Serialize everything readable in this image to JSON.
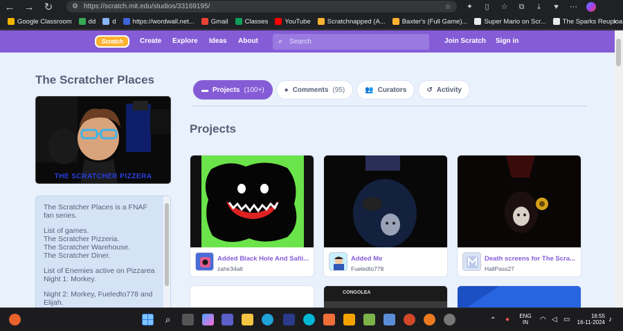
{
  "browser": {
    "url": "https://scratch.mit.edu/studios/33169195/",
    "bookmarks": [
      {
        "label": "Google Classroom",
        "color": "#f4b400"
      },
      {
        "label": "dd",
        "color": "#34a853"
      },
      {
        "label": "d",
        "color": "#8ab4f8"
      },
      {
        "label": "https://wordwall.net...",
        "color": "#3c64d8"
      },
      {
        "label": "Gmail",
        "color": "#ea4335"
      },
      {
        "label": "Classes",
        "color": "#0f9d58"
      },
      {
        "label": "YouTube",
        "color": "#ff0000"
      },
      {
        "label": "Scratchnapped (A...",
        "color": "#fcb230"
      },
      {
        "label": "Baxter's (Full Game)...",
        "color": "#fcb230"
      },
      {
        "label": "Super Mario on Scr...",
        "color": "#e8eaed"
      },
      {
        "label": "The Sparks Reuploa...",
        "color": "#e8eaed"
      }
    ]
  },
  "nav": {
    "logo": "Scratch",
    "create": "Create",
    "explore": "Explore",
    "ideas": "Ideas",
    "about": "About",
    "search_placeholder": "Search",
    "join": "Join Scratch",
    "signin": "Sign in"
  },
  "studio": {
    "title": "The Scratcher Places",
    "thumbnail_caption": "THE SCRATCHER PIZZERA",
    "description": {
      "intro": "The Scratcher Places is a FNAF fan series.",
      "games_heading": "List of games.",
      "games": [
        "The Scratcher Pizzeria.",
        "The Scratcher Warehouse.",
        "The Scratcher Diner."
      ],
      "enemies_heading": "List of Enemies active on Pizzarea",
      "night1": "Night 1: Morkey.",
      "night2": "Night 2: Morkey, Fueledto778 and Elijah."
    }
  },
  "tabs": [
    {
      "label": "Projects",
      "count": "(100+)",
      "icon": "folder-icon",
      "active": true
    },
    {
      "label": "Comments",
      "count": "(95)",
      "icon": "comment-icon",
      "active": false
    },
    {
      "label": "Curators",
      "count": "",
      "icon": "people-icon",
      "active": false
    },
    {
      "label": "Activity",
      "count": "",
      "icon": "history-icon",
      "active": false
    }
  ],
  "projects": {
    "heading": "Projects",
    "items": [
      {
        "title": "Added Black Hole And Salti...",
        "author": "zahir34alt"
      },
      {
        "title": "Added Me",
        "author": "Fueledto778"
      },
      {
        "title": "Death screens for The Scra...",
        "author": "HallPass27"
      }
    ],
    "partial_card_text": "CONGOLEA"
  },
  "taskbar": {
    "language": "ENG",
    "region": "IN",
    "time": "16:55",
    "date": "16-11-2024"
  }
}
